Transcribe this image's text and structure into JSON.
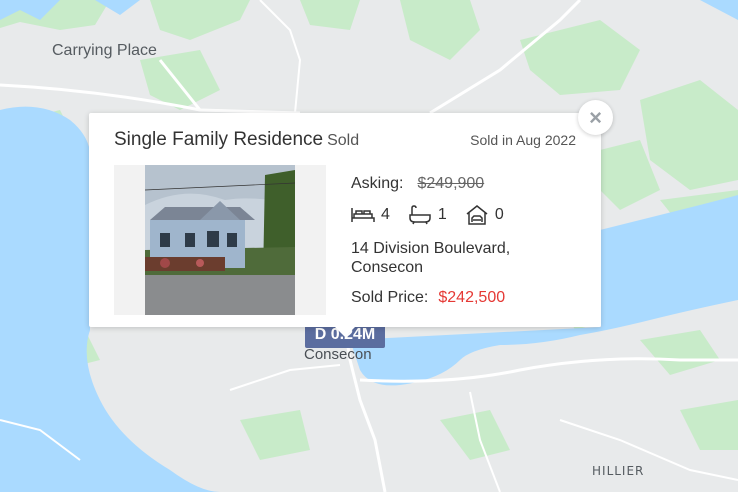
{
  "map": {
    "colors": {
      "water": "#aadaff",
      "land": "#e8eaeb",
      "park": "#c8ebc9",
      "road": "#ffffff"
    },
    "labels": {
      "carrying_place": "Carrying Place",
      "consecon": "Consecon",
      "hillier": "HILLIER"
    }
  },
  "marker": {
    "text": "D 0.24M"
  },
  "popup": {
    "type": "Single Family Residence",
    "status": "Sold",
    "sold_date": "Sold in Aug 2022",
    "asking_label": "Asking:",
    "asking_price": "$249,900",
    "beds": "4",
    "baths": "1",
    "garage": "0",
    "address_line1": "14 Division Boulevard,",
    "address_line2": "Consecon",
    "sold_price_label": "Sold Price:",
    "sold_price": "$242,500",
    "close_symbol": "×"
  }
}
